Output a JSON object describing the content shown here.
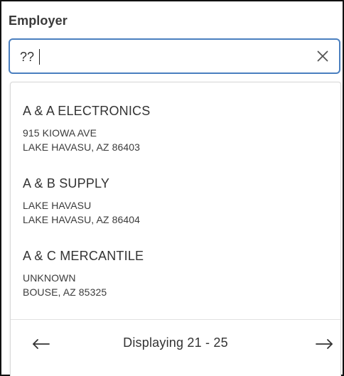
{
  "field": {
    "label": "Employer",
    "value": "??",
    "clear_icon": "close-icon"
  },
  "results": [
    {
      "name": "A & A ELECTRONICS",
      "address1": "915 KIOWA AVE",
      "address2": "LAKE HAVASU, AZ 86403"
    },
    {
      "name": "A & B SUPPLY",
      "address1": "LAKE HAVASU",
      "address2": "LAKE HAVASU, AZ 86404"
    },
    {
      "name": "A & C MERCANTILE",
      "address1": "UNKNOWN",
      "address2": "BOUSE, AZ 85325"
    }
  ],
  "pager": {
    "text": "Displaying 21 - 25",
    "prev_icon": "arrow-left-icon",
    "next_icon": "arrow-right-icon"
  },
  "colors": {
    "focus_border": "#4a7fbf",
    "text": "#333333",
    "label": "#3a3a3a"
  }
}
